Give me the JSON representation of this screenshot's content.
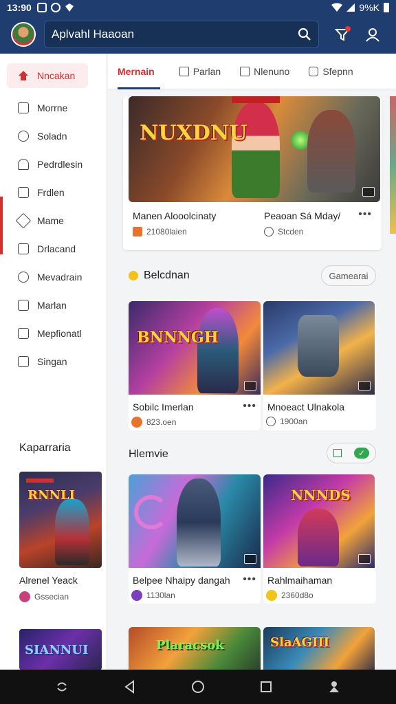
{
  "status": {
    "time": "13:90",
    "battery": "9%K"
  },
  "header": {
    "search_value": "Aplvahl Haaoan"
  },
  "sidebar": {
    "items": [
      {
        "label": "Nncakan",
        "icon": "home-icon"
      },
      {
        "label": "Morrne",
        "icon": "bookmark-icon"
      },
      {
        "label": "Soladn",
        "icon": "search-icon"
      },
      {
        "label": "Pedrdlesin",
        "icon": "person-icon"
      },
      {
        "label": "Frdlen",
        "icon": "calendar-icon"
      },
      {
        "label": "Mame",
        "icon": "tag-icon"
      },
      {
        "label": "Drlacand",
        "icon": "grid-icon"
      },
      {
        "label": "Mevadrain",
        "icon": "shield-icon"
      },
      {
        "label": "Marlan",
        "icon": "square-icon"
      },
      {
        "label": "Mepfionatl",
        "icon": "book-icon"
      },
      {
        "label": "Singan",
        "icon": "chat-icon"
      }
    ],
    "section_title": "Kaparraria",
    "card": {
      "title": "Alrenel Yeack",
      "meta": "Gssecian"
    }
  },
  "tabs": [
    {
      "label": "Mernain",
      "icon": ""
    },
    {
      "label": "Parlan",
      "icon": "file-icon"
    },
    {
      "label": "Nlenuno",
      "icon": "music-icon"
    },
    {
      "label": "Sfepnn",
      "icon": "camera-icon"
    }
  ],
  "featured": {
    "art_title": "NUXDNU",
    "left": {
      "title": "Manen Alooolcinaty",
      "meta": "21080laien"
    },
    "right": {
      "title": "Peaoan Sá Mday/",
      "meta": "Stcden"
    }
  },
  "section1": {
    "title": "Belcdnan",
    "button": "Gamearai",
    "cards": [
      {
        "title": "Sobilc Imerlan",
        "meta": "823.oen",
        "art": "BNNNGH",
        "badge_color": "#e8732a"
      },
      {
        "title": "Mnoeact Ulnakola",
        "meta": "1900an",
        "art": "",
        "badge_color": ""
      }
    ]
  },
  "section2": {
    "title": "Hlemvie",
    "cards": [
      {
        "title": "Belpee Nhaipy dangah",
        "meta": "1130lan",
        "art": "",
        "badge_color": "#7b3fbd"
      },
      {
        "title": "Rahlmaihaman",
        "meta": "2360d8o",
        "art": "NNNDS",
        "badge_color": "#f0c419"
      }
    ]
  },
  "section3": {
    "cards": [
      {
        "art": "Plaracsok"
      },
      {
        "art": "SlaAGIII"
      }
    ]
  },
  "sidebar_art": {
    "card1": "RNNLI",
    "card2": "SIANNUI"
  }
}
